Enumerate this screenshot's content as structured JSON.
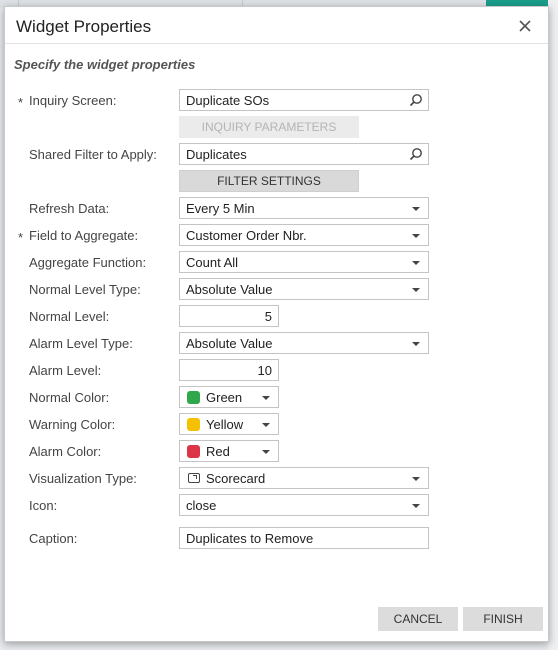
{
  "dialog": {
    "title": "Widget Properties",
    "subtitle": "Specify the widget properties",
    "close_icon": "close-icon"
  },
  "fields": {
    "inquiry_screen": {
      "label": "Inquiry Screen:",
      "required_mark": "*",
      "value": "Duplicate SOs"
    },
    "inquiry_parameters_button": "INQUIRY PARAMETERS",
    "shared_filter": {
      "label": "Shared Filter to Apply:",
      "value": "Duplicates"
    },
    "filter_settings_button": "FILTER SETTINGS",
    "refresh_data": {
      "label": "Refresh Data:",
      "value": "Every 5 Min"
    },
    "field_to_aggregate": {
      "label": "Field to Aggregate:",
      "required_mark": "*",
      "value": "Customer Order Nbr."
    },
    "aggregate_function": {
      "label": "Aggregate Function:",
      "value": "Count All"
    },
    "normal_level_type": {
      "label": "Normal Level Type:",
      "value": "Absolute Value"
    },
    "normal_level": {
      "label": "Normal Level:",
      "value": "5"
    },
    "alarm_level_type": {
      "label": "Alarm Level Type:",
      "value": "Absolute Value"
    },
    "alarm_level": {
      "label": "Alarm Level:",
      "value": "10"
    },
    "normal_color": {
      "label": "Normal Color:",
      "value": "Green",
      "swatch": "#2ea84a"
    },
    "warning_color": {
      "label": "Warning Color:",
      "value": "Yellow",
      "swatch": "#f5c000"
    },
    "alarm_color": {
      "label": "Alarm Color:",
      "value": "Red",
      "swatch": "#dc3545"
    },
    "visualization_type": {
      "label": "Visualization Type:",
      "value": "Scorecard"
    },
    "icon": {
      "label": "Icon:",
      "value": "close"
    },
    "caption": {
      "label": "Caption:",
      "value": "Duplicates to Remove"
    }
  },
  "footer": {
    "cancel_label": "CANCEL",
    "finish_label": "FINISH"
  }
}
